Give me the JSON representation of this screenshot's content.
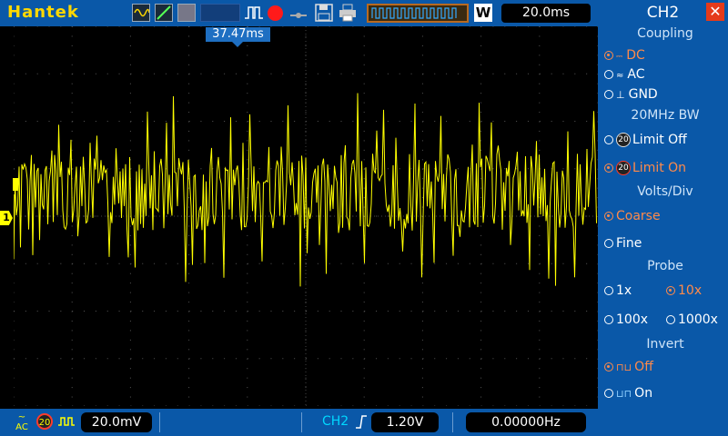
{
  "topbar": {
    "brand": "Hantek",
    "timebase": "20.0ms",
    "acq_mode_letter": "W"
  },
  "trigger_marker": "37.47ms",
  "bottombar": {
    "ch1_coupling": "AC",
    "ch1_bw": "20",
    "ch1_volts": "20.0mV",
    "trigger_source": "CH2",
    "trigger_level": "1.20V",
    "frequency": "0.00000Hz"
  },
  "panel": {
    "title": "CH2",
    "coupling": {
      "label": "Coupling",
      "options": [
        "DC",
        "AC",
        "GND"
      ],
      "selected": "DC"
    },
    "bandwidth": {
      "label": "20MHz BW",
      "options": [
        "Limit Off",
        "Limit On"
      ],
      "selected": "Limit On"
    },
    "voltsdiv": {
      "label": "Volts/Div",
      "options": [
        "Coarse",
        "Fine"
      ],
      "selected": "Coarse"
    },
    "probe": {
      "label": "Probe",
      "options": [
        "1x",
        "10x",
        "100x",
        "1000x"
      ],
      "selected": "10x"
    },
    "invert": {
      "label": "Invert",
      "options": [
        "Off",
        "On"
      ],
      "selected": "Off"
    }
  },
  "colors": {
    "trace": "#ffff00",
    "panel": "#0a58a8",
    "selected": "#ff8a4a"
  }
}
